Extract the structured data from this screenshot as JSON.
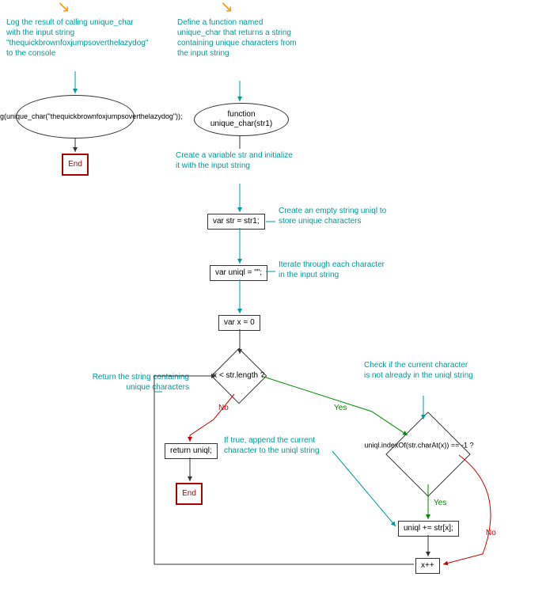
{
  "diagram": {
    "left": {
      "comment": "Log the result of calling unique_char with the input string \"thequickbrownfoxjumpsoverthelazydog\" to the console",
      "ellipse": "console.log(unique_char(\"thequickbrownfoxjumpsoverthelazydog\"));",
      "end": "End"
    },
    "right": {
      "comment_fn": "Define a function named unique_char that returns a string containing unique characters from the input string",
      "ellipse_fn": "function unique_char(str1)",
      "comment_var": "Create a variable str and initialize it with the input string",
      "rect_var": "var str = str1;",
      "comment_uniql": "Create an empty string uniql to store unique characters",
      "rect_uniql": "var uniql = \"\";",
      "comment_loop": "Iterate through each character in the input string",
      "rect_x0": "var x = 0",
      "dec_loop": "x < str.length ?",
      "comment_return": "Return the string containing unique characters",
      "rect_return": "return uniql;",
      "end2": "End",
      "comment_check": "Check if the current character is not already in the uniql string",
      "dec_check": "uniql.indexOf(str.charAt(x)) == -1 ?",
      "comment_append": "If true, append the current character to the uniql string",
      "rect_append": "uniql += str[x];",
      "rect_inc": "x++",
      "yes": "Yes",
      "no": "No"
    }
  }
}
